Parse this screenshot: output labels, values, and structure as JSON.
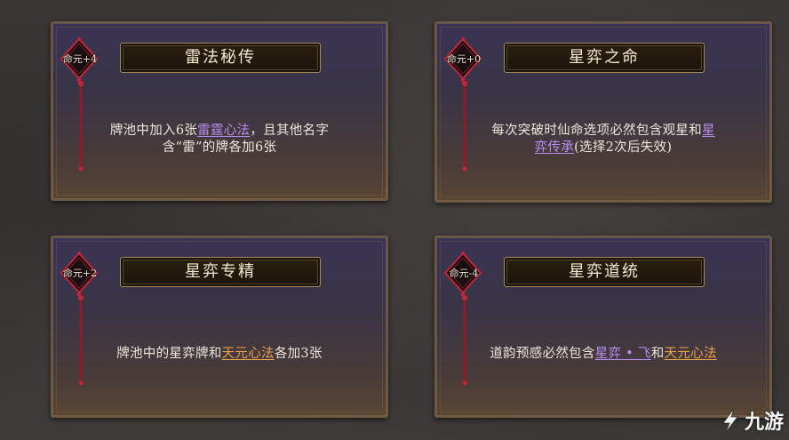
{
  "cards": [
    {
      "badge": "命元+4",
      "title": "雷法秘传",
      "desc": {
        "line1_a": "牌池中加入6张",
        "line1_link": "雷霆心法",
        "line1_b": "，且其他名字",
        "line2": "含“雷”的牌各加6张"
      }
    },
    {
      "badge": "命元+0",
      "title": "星弈之命",
      "desc": {
        "line1_a": "每次突破时仙命选项必然包含观星和",
        "line1_link": "星",
        "line2_link": "弈传承",
        "line2_b": "(选择2次后失效)"
      }
    },
    {
      "badge": "命元+2",
      "title": "星弈专精",
      "desc": {
        "a": "牌池中的星弈牌和",
        "link": "天元心法",
        "b": "各加3张"
      }
    },
    {
      "badge": "命元-4",
      "title": "星弈道统",
      "desc": {
        "a": "道韵预感必然包含",
        "link1": "星弈 • 飞",
        "mid": "和",
        "link2": "天元心法"
      }
    }
  ],
  "watermark": {
    "text": "九游",
    "icon": "jiuyou-logo-icon"
  },
  "colors": {
    "card_link_purple": "#b88cf0",
    "card_link_orange": "#e8a04a",
    "title_text": "#f2e8d0",
    "badge_frame": "#c0283a"
  }
}
